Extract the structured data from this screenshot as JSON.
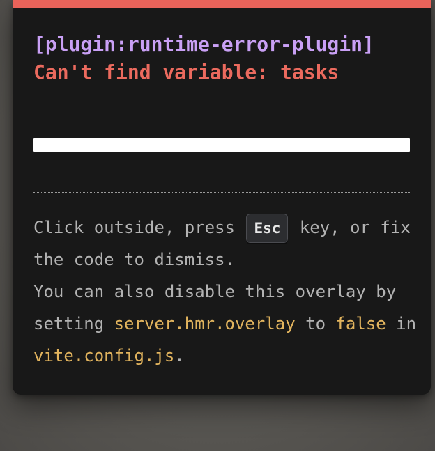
{
  "colors": {
    "accent_bar": "#e9635a",
    "plugin_color": "#c9a0f5",
    "message_color": "#eb6a5e",
    "code_color": "#e2b45e",
    "tip_text": "#b3b3b3",
    "panel_bg": "#181818"
  },
  "error": {
    "plugin": "[plugin:runtime-error-plugin]",
    "message": "Can't find variable: tasks"
  },
  "tip": {
    "part1": "Click outside, press ",
    "key": "Esc",
    "part2": " key, or fix the code to dismiss.",
    "part3": "You can also disable this overlay by setting ",
    "config_option": "server.hmr.overlay",
    "part4": " to ",
    "value": "false",
    "part5": " in ",
    "config_file": "vite.config.js",
    "part6": "."
  }
}
